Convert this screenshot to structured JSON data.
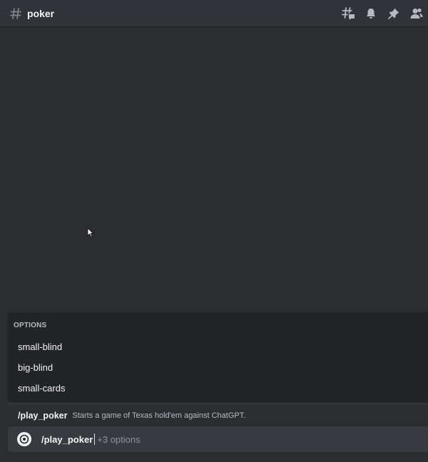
{
  "header": {
    "channel_icon": "hash-icon",
    "channel_name": "poker",
    "icons": [
      "threads-icon",
      "bell-icon",
      "pin-icon",
      "members-icon"
    ]
  },
  "options": {
    "title": "OPTIONS",
    "items": [
      "small-blind",
      "big-blind",
      "small-cards"
    ]
  },
  "command_hint": {
    "name": "/play_poker",
    "description": "Starts a game of Texas hold'em against ChatGPT."
  },
  "input": {
    "command": "/play_poker",
    "placeholder": "+3 options"
  },
  "colors": {
    "background": "#2b2d31",
    "header": "#313338",
    "panel": "#232428",
    "input": "#383a40",
    "text": "#f2f3f5",
    "muted": "#b5bac1"
  }
}
